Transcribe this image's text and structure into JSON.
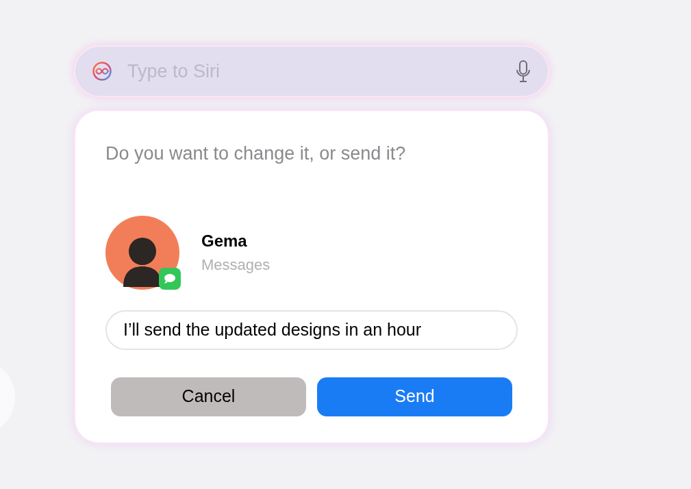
{
  "siri_bar": {
    "placeholder": "Type to Siri"
  },
  "prompt": "Do you want to change it, or send it?",
  "contact": {
    "name": "Gema",
    "app": "Messages"
  },
  "message": {
    "value": "I’ll send the updated designs in an hour"
  },
  "buttons": [
    {
      "label": "Cancel",
      "kind": "secondary"
    },
    {
      "label": "Send",
      "kind": "primary"
    }
  ]
}
